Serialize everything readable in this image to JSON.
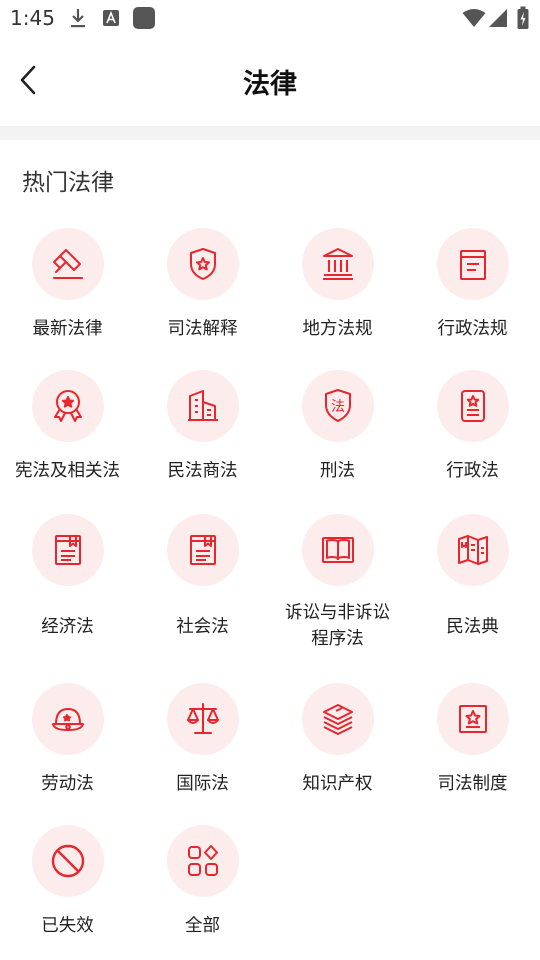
{
  "status_bar": {
    "time": "1:45"
  },
  "header": {
    "title": "法律"
  },
  "section": {
    "title": "热门法律"
  },
  "categories": [
    {
      "label": "最新法律",
      "icon": "gavel-icon"
    },
    {
      "label": "司法解释",
      "icon": "shield-star-icon"
    },
    {
      "label": "地方法规",
      "icon": "building-icon"
    },
    {
      "label": "行政法规",
      "icon": "document-icon"
    },
    {
      "label": "宪法及相关法",
      "icon": "medal-icon"
    },
    {
      "label": "民法商法",
      "icon": "office-building-icon"
    },
    {
      "label": "刑法",
      "icon": "shield-law-icon"
    },
    {
      "label": "行政法",
      "icon": "star-document-icon"
    },
    {
      "label": "经济法",
      "icon": "book-bookmark-icon"
    },
    {
      "label": "社会法",
      "icon": "book-bookmark-icon"
    },
    {
      "label": "诉讼与非诉讼\n程序法",
      "icon": "open-book-icon"
    },
    {
      "label": "民法典",
      "icon": "folded-map-icon"
    },
    {
      "label": "劳动法",
      "icon": "hard-hat-icon"
    },
    {
      "label": "国际法",
      "icon": "scales-icon"
    },
    {
      "label": "知识产权",
      "icon": "stack-icon"
    },
    {
      "label": "司法制度",
      "icon": "star-frame-icon"
    },
    {
      "label": "已失效",
      "icon": "prohibited-icon"
    },
    {
      "label": "全部",
      "icon": "grid-icon"
    }
  ],
  "colors": {
    "accent": "#e8262e",
    "icon_bg": "#fdecec",
    "band": "#f3f3f3"
  }
}
